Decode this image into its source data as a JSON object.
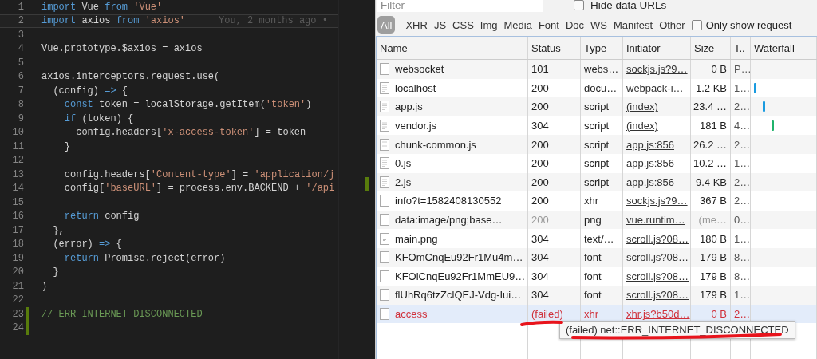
{
  "editor": {
    "lines": [
      {
        "number": "1",
        "current": false,
        "added": false,
        "tokens": [
          {
            "kind": "keyword",
            "text": "import"
          },
          {
            "kind": "plain",
            "text": " Vue "
          },
          {
            "kind": "keyword",
            "text": "from "
          },
          {
            "kind": "string",
            "text": "'Vue'"
          }
        ]
      },
      {
        "number": "2",
        "current": true,
        "added": false,
        "annotation": "You, 2 months ago •",
        "tokens": [
          {
            "kind": "keyword",
            "text": "import"
          },
          {
            "kind": "plain",
            "text": " axios "
          },
          {
            "kind": "keyword",
            "text": "from "
          },
          {
            "kind": "string",
            "text": "'axios'"
          }
        ]
      },
      {
        "number": "3",
        "current": false,
        "added": false
      },
      {
        "number": "4",
        "current": false,
        "added": false,
        "tokens": [
          {
            "kind": "plain",
            "text": "Vue.prototype.$axios = axios"
          }
        ]
      },
      {
        "number": "5",
        "current": false,
        "added": false
      },
      {
        "number": "6",
        "current": false,
        "added": false,
        "tokens": [
          {
            "kind": "plain",
            "text": "axios.interceptors.request.use("
          }
        ]
      },
      {
        "number": "7",
        "current": false,
        "added": false,
        "tokens": [
          {
            "kind": "plain",
            "text": "  (config) "
          },
          {
            "kind": "keyword",
            "text": "=>"
          },
          {
            "kind": "plain",
            "text": " {"
          }
        ]
      },
      {
        "number": "8",
        "current": false,
        "added": false,
        "tokens": [
          {
            "kind": "keyword",
            "text": "    const"
          },
          {
            "kind": "plain",
            "text": " token = localStorage.getItem("
          },
          {
            "kind": "string",
            "text": "'token'"
          },
          {
            "kind": "plain",
            "text": ")"
          }
        ]
      },
      {
        "number": "9",
        "current": false,
        "added": false,
        "tokens": [
          {
            "kind": "keyword",
            "text": "    if"
          },
          {
            "kind": "plain",
            "text": " (token) {"
          }
        ]
      },
      {
        "number": "10",
        "current": false,
        "added": false,
        "tokens": [
          {
            "kind": "plain",
            "text": "      config.headers["
          },
          {
            "kind": "string",
            "text": "'x-access-token'"
          },
          {
            "kind": "plain",
            "text": "] = token"
          }
        ]
      },
      {
        "number": "11",
        "current": false,
        "added": false,
        "tokens": [
          {
            "kind": "plain",
            "text": "    }"
          }
        ]
      },
      {
        "number": "12",
        "current": false,
        "added": false
      },
      {
        "number": "13",
        "current": false,
        "added": false,
        "tokens": [
          {
            "kind": "plain",
            "text": "    config.headers["
          },
          {
            "kind": "string",
            "text": "'Content-type'"
          },
          {
            "kind": "plain",
            "text": "] = "
          },
          {
            "kind": "string",
            "text": "'application/j"
          }
        ]
      },
      {
        "number": "14",
        "current": false,
        "added": false,
        "tokens": [
          {
            "kind": "plain",
            "text": "    config["
          },
          {
            "kind": "string",
            "text": "'baseURL'"
          },
          {
            "kind": "plain",
            "text": "] = process.env.BACKEND + "
          },
          {
            "kind": "string",
            "text": "'/api"
          }
        ]
      },
      {
        "number": "15",
        "current": false,
        "added": false
      },
      {
        "number": "16",
        "current": false,
        "added": false,
        "tokens": [
          {
            "kind": "keyword",
            "text": "    return"
          },
          {
            "kind": "plain",
            "text": " config"
          }
        ]
      },
      {
        "number": "17",
        "current": false,
        "added": false,
        "tokens": [
          {
            "kind": "plain",
            "text": "  },"
          }
        ]
      },
      {
        "number": "18",
        "current": false,
        "added": false,
        "tokens": [
          {
            "kind": "plain",
            "text": "  (error) "
          },
          {
            "kind": "keyword",
            "text": "=>"
          },
          {
            "kind": "plain",
            "text": " {"
          }
        ]
      },
      {
        "number": "19",
        "current": false,
        "added": false,
        "tokens": [
          {
            "kind": "keyword",
            "text": "    return"
          },
          {
            "kind": "plain",
            "text": " Promise.reject(error)"
          }
        ]
      },
      {
        "number": "20",
        "current": false,
        "added": false,
        "tokens": [
          {
            "kind": "plain",
            "text": "  }"
          }
        ]
      },
      {
        "number": "21",
        "current": false,
        "added": false,
        "tokens": [
          {
            "kind": "plain",
            "text": ")"
          }
        ]
      },
      {
        "number": "22",
        "current": false,
        "added": false
      },
      {
        "number": "23",
        "current": false,
        "added": true,
        "tokens": [
          {
            "kind": "comment",
            "text": "// ERR_INTERNET_DISCONNECTED"
          }
        ]
      },
      {
        "number": "24",
        "current": false,
        "added": true
      }
    ]
  },
  "network": {
    "filter": {
      "placeholder": "Filter"
    },
    "hide_data_urls": {
      "label": "Hide data URLs",
      "checked": false
    },
    "types": [
      {
        "label": "All",
        "selected": true
      },
      {
        "label": "XHR",
        "selected": false
      },
      {
        "label": "JS",
        "selected": false
      },
      {
        "label": "CSS",
        "selected": false
      },
      {
        "label": "Img",
        "selected": false
      },
      {
        "label": "Media",
        "selected": false
      },
      {
        "label": "Font",
        "selected": false
      },
      {
        "label": "Doc",
        "selected": false
      },
      {
        "label": "WS",
        "selected": false
      },
      {
        "label": "Manifest",
        "selected": false
      },
      {
        "label": "Other",
        "selected": false
      }
    ],
    "only_show": {
      "label": "Only show request",
      "checked": false
    },
    "columns": [
      "Name",
      "Status",
      "Type",
      "Initiator",
      "Size",
      "T..",
      "Waterfall"
    ],
    "rows": [
      {
        "kind": "blank",
        "name": "websocket",
        "status": "101",
        "type": "webs…",
        "initiator": "sockjs.js?9…",
        "size": "0 B",
        "time": "P…",
        "dimmed": false,
        "failed": false,
        "highlighted": false
      },
      {
        "kind": "document",
        "name": "localhost",
        "status": "200",
        "type": "docu…",
        "initiator": "webpack-i…",
        "size": "1.2 KB",
        "time": "1…",
        "dimmed": false,
        "failed": false,
        "highlighted": false,
        "color": "#1a9be0"
      },
      {
        "kind": "document",
        "name": "app.js",
        "status": "200",
        "type": "script",
        "initiator": "(index)",
        "size": "23.4 …",
        "time": "2…",
        "dimmed": false,
        "failed": false,
        "highlighted": false,
        "color": "#1a9be0"
      },
      {
        "kind": "document",
        "name": "vendor.js",
        "status": "304",
        "type": "script",
        "initiator": "(index)",
        "size": "181 B",
        "time": "4…",
        "dimmed": false,
        "failed": false,
        "highlighted": false,
        "color": "#1fb36b"
      },
      {
        "kind": "document",
        "name": "chunk-common.js",
        "status": "200",
        "type": "script",
        "initiator": "app.js:856",
        "size": "26.2 …",
        "time": "2…",
        "dimmed": false,
        "failed": false,
        "highlighted": false
      },
      {
        "kind": "document",
        "name": "0.js",
        "status": "200",
        "type": "script",
        "initiator": "app.js:856",
        "size": "10.2 …",
        "time": "1…",
        "dimmed": false,
        "failed": false,
        "highlighted": false
      },
      {
        "kind": "document",
        "name": "2.js",
        "status": "200",
        "type": "script",
        "initiator": "app.js:856",
        "size": "9.4 KB",
        "time": "2…",
        "dimmed": false,
        "failed": false,
        "highlighted": false
      },
      {
        "kind": "blank",
        "name": "info?t=1582408130552",
        "status": "200",
        "type": "xhr",
        "initiator": "sockjs.js?9…",
        "size": "367 B",
        "time": "2…",
        "dimmed": false,
        "failed": false,
        "highlighted": false
      },
      {
        "kind": "blank",
        "name": "data:image/png;base…",
        "status": "200",
        "type": "png",
        "initiator": "vue.runtim…",
        "size": "(me…",
        "time": "0…",
        "dimmed": true,
        "failed": false,
        "highlighted": false
      },
      {
        "kind": "image",
        "name": "main.png",
        "status": "304",
        "type": "text/…",
        "initiator": "scroll.js?08…",
        "size": "180 B",
        "time": "1…",
        "dimmed": false,
        "failed": false,
        "highlighted": false
      },
      {
        "kind": "blank",
        "name": "KFOmCnqEu92Fr1Mu4m…",
        "status": "304",
        "type": "font",
        "initiator": "scroll.js?08…",
        "size": "179 B",
        "time": "8…",
        "dimmed": false,
        "failed": false,
        "highlighted": false
      },
      {
        "kind": "blank",
        "name": "KFOlCnqEu92Fr1MmEU9…",
        "status": "304",
        "type": "font",
        "initiator": "scroll.js?08…",
        "size": "179 B",
        "time": "8…",
        "dimmed": false,
        "failed": false,
        "highlighted": false
      },
      {
        "kind": "blank",
        "name": "flUhRq6tzZclQEJ-Vdg-Iui…",
        "status": "304",
        "type": "font",
        "initiator": "scroll.js?08…",
        "size": "179 B",
        "time": "1…",
        "dimmed": false,
        "failed": false,
        "highlighted": false
      },
      {
        "kind": "blank",
        "name": "access",
        "status": "(failed)",
        "type": "xhr",
        "initiator": "xhr.js?b50d…",
        "size": "0 B",
        "time": "2…",
        "dimmed": false,
        "failed": true,
        "highlighted": true
      }
    ],
    "tooltip": "(failed) net::ERR_INTERNET_DISCONNECTED"
  }
}
